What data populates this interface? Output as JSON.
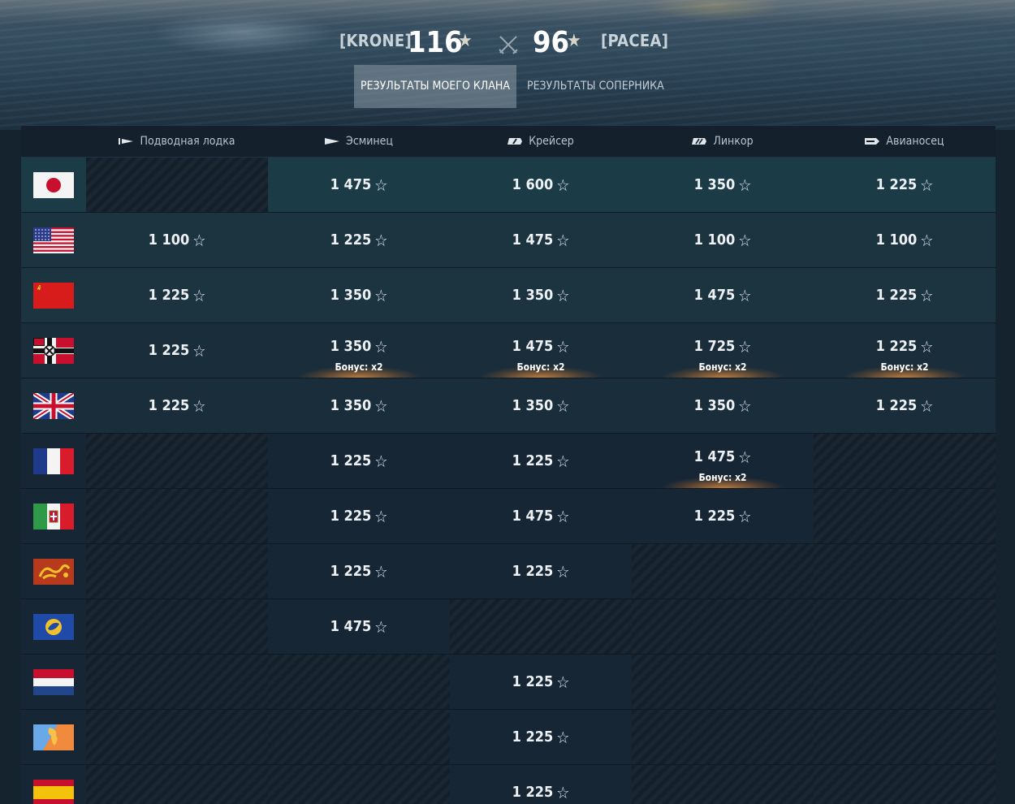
{
  "header": {
    "own_tag": "[KRONE]",
    "own_score": "116",
    "enemy_tag": "[PACEA]",
    "enemy_score": "96",
    "star": "★",
    "tabs": [
      {
        "label": "РЕЗУЛЬТАТЫ МОЕГО КЛАНА",
        "active": true
      },
      {
        "label": "РЕЗУЛЬТАТЫ СОПЕРНИКА",
        "active": false
      }
    ]
  },
  "columns": [
    {
      "label": "Подводная лодка",
      "icon": "submarine-icon"
    },
    {
      "label": "Эсминец",
      "icon": "destroyer-icon"
    },
    {
      "label": "Крейсер",
      "icon": "cruiser-icon"
    },
    {
      "label": "Линкор",
      "icon": "battleship-icon"
    },
    {
      "label": "Авианосец",
      "icon": "aircraft-carrier-icon"
    }
  ],
  "star_glyph": "☆",
  "bonus_label": "Бонус: x2",
  "rows": [
    {
      "nation": "japan",
      "flag_icon": "japan-flag-icon",
      "cells": [
        null,
        {
          "value": "1 475"
        },
        {
          "value": "1 600"
        },
        {
          "value": "1 350"
        },
        {
          "value": "1 225"
        }
      ]
    },
    {
      "nation": "usa",
      "flag_icon": "usa-flag-icon",
      "cells": [
        {
          "value": "1 100"
        },
        {
          "value": "1 225"
        },
        {
          "value": "1 475"
        },
        {
          "value": "1 100"
        },
        {
          "value": "1 100"
        }
      ]
    },
    {
      "nation": "ussr",
      "flag_icon": "ussr-flag-icon",
      "cells": [
        {
          "value": "1 225"
        },
        {
          "value": "1 350"
        },
        {
          "value": "1 350"
        },
        {
          "value": "1 475"
        },
        {
          "value": "1 225"
        }
      ]
    },
    {
      "nation": "germany",
      "flag_icon": "germany-flag-icon",
      "cells": [
        {
          "value": "1 225"
        },
        {
          "value": "1 350",
          "bonus": true
        },
        {
          "value": "1 475",
          "bonus": true
        },
        {
          "value": "1 725",
          "bonus": true
        },
        {
          "value": "1 225",
          "bonus": true
        }
      ]
    },
    {
      "nation": "uk",
      "flag_icon": "uk-flag-icon",
      "cells": [
        {
          "value": "1 225"
        },
        {
          "value": "1 350"
        },
        {
          "value": "1 350"
        },
        {
          "value": "1 350"
        },
        {
          "value": "1 225"
        }
      ]
    },
    {
      "nation": "france",
      "flag_icon": "france-flag-icon",
      "cells": [
        null,
        {
          "value": "1 225"
        },
        {
          "value": "1 225"
        },
        {
          "value": "1 475",
          "bonus": true
        },
        null
      ]
    },
    {
      "nation": "italy",
      "flag_icon": "italy-flag-icon",
      "cells": [
        null,
        {
          "value": "1 225"
        },
        {
          "value": "1 475"
        },
        {
          "value": "1 225"
        },
        null
      ]
    },
    {
      "nation": "pan-asia",
      "flag_icon": "pan-asia-flag-icon",
      "cells": [
        null,
        {
          "value": "1 225"
        },
        {
          "value": "1 225"
        },
        null,
        null
      ]
    },
    {
      "nation": "europe",
      "flag_icon": "europe-flag-icon",
      "cells": [
        null,
        {
          "value": "1 475"
        },
        null,
        null,
        null
      ]
    },
    {
      "nation": "netherlands",
      "flag_icon": "netherlands-flag-icon",
      "cells": [
        null,
        null,
        {
          "value": "1 225"
        },
        null,
        null
      ]
    },
    {
      "nation": "pan-america",
      "flag_icon": "pan-america-flag-icon",
      "cells": [
        null,
        null,
        {
          "value": "1 225"
        },
        null,
        null
      ]
    },
    {
      "nation": "spain",
      "flag_icon": "spain-flag-icon",
      "cells": [
        null,
        null,
        {
          "value": "1 225"
        },
        null,
        null
      ]
    }
  ]
}
